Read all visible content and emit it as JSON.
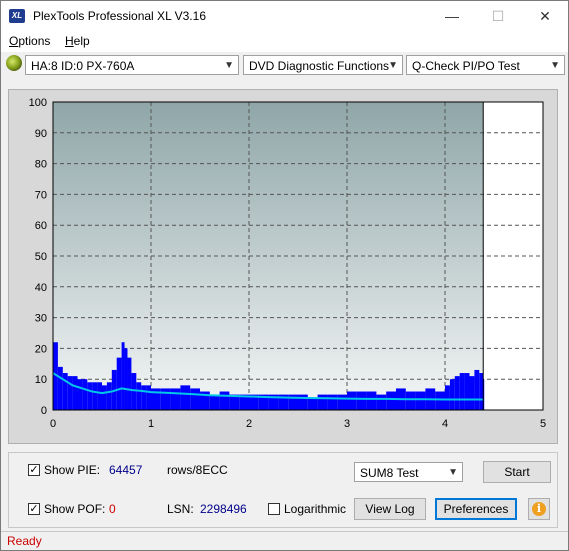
{
  "window": {
    "title": "PlexTools Professional XL V3.16",
    "icon_text": "XL",
    "minimize": "—",
    "maximize": "☐",
    "close": "✕"
  },
  "menu": {
    "options": "ptions",
    "options_hotkey": "O",
    "help": "elp",
    "help_hotkey": "H"
  },
  "toolbar": {
    "drive": "HA:8 ID:0  PX-760A",
    "function": "DVD Diagnostic Functions",
    "test": "Q-Check PI/PO Test"
  },
  "colors": {
    "plot_top": "#8fa6a8",
    "plot_bottom": "#f4f6f6",
    "bars": "#0000ff",
    "line": "#00c8e6",
    "status_text": "#cc0000",
    "value_text": "#00008b"
  },
  "chart_data": {
    "type": "bar",
    "xlim": [
      0,
      5
    ],
    "ylim": [
      0,
      100
    ],
    "x_ticks": [
      "0",
      "1",
      "2",
      "3",
      "4",
      "5"
    ],
    "y_ticks": [
      "0",
      "10",
      "20",
      "30",
      "40",
      "50",
      "60",
      "70",
      "80",
      "90",
      "100"
    ],
    "scan_end_x": 4.39,
    "grid": true,
    "series": [
      {
        "kind": "bars",
        "points": [
          [
            0.0,
            22
          ],
          [
            0.05,
            14
          ],
          [
            0.1,
            12
          ],
          [
            0.15,
            11
          ],
          [
            0.2,
            11
          ],
          [
            0.25,
            10
          ],
          [
            0.3,
            10
          ],
          [
            0.35,
            9
          ],
          [
            0.4,
            9
          ],
          [
            0.45,
            9
          ],
          [
            0.5,
            8
          ],
          [
            0.55,
            9
          ],
          [
            0.6,
            13
          ],
          [
            0.65,
            17
          ],
          [
            0.7,
            22
          ],
          [
            0.73,
            20
          ],
          [
            0.76,
            17
          ],
          [
            0.8,
            12
          ],
          [
            0.85,
            9
          ],
          [
            0.9,
            8
          ],
          [
            0.95,
            8
          ],
          [
            1.0,
            7
          ],
          [
            1.1,
            7
          ],
          [
            1.2,
            7
          ],
          [
            1.3,
            8
          ],
          [
            1.4,
            7
          ],
          [
            1.5,
            6
          ],
          [
            1.6,
            5
          ],
          [
            1.7,
            6
          ],
          [
            1.8,
            5
          ],
          [
            1.9,
            5
          ],
          [
            2.0,
            5
          ],
          [
            2.1,
            5
          ],
          [
            2.2,
            5
          ],
          [
            2.3,
            5
          ],
          [
            2.4,
            5
          ],
          [
            2.5,
            5
          ],
          [
            2.6,
            4
          ],
          [
            2.7,
            5
          ],
          [
            2.8,
            5
          ],
          [
            2.9,
            5
          ],
          [
            3.0,
            6
          ],
          [
            3.1,
            6
          ],
          [
            3.2,
            6
          ],
          [
            3.3,
            5
          ],
          [
            3.4,
            6
          ],
          [
            3.5,
            7
          ],
          [
            3.6,
            6
          ],
          [
            3.7,
            6
          ],
          [
            3.8,
            7
          ],
          [
            3.9,
            6
          ],
          [
            4.0,
            8
          ],
          [
            4.05,
            10
          ],
          [
            4.1,
            11
          ],
          [
            4.15,
            12
          ],
          [
            4.2,
            12
          ],
          [
            4.25,
            11
          ],
          [
            4.3,
            13
          ],
          [
            4.35,
            12
          ],
          [
            4.39,
            10
          ]
        ]
      },
      {
        "kind": "line",
        "points": [
          [
            0.0,
            12
          ],
          [
            0.1,
            10
          ],
          [
            0.2,
            8
          ],
          [
            0.3,
            7
          ],
          [
            0.4,
            6
          ],
          [
            0.5,
            5.5
          ],
          [
            0.6,
            6
          ],
          [
            0.7,
            7
          ],
          [
            0.8,
            6.5
          ],
          [
            0.9,
            6.2
          ],
          [
            1.0,
            5.8
          ],
          [
            1.2,
            5.5
          ],
          [
            1.4,
            5.2
          ],
          [
            1.6,
            4.8
          ],
          [
            1.8,
            4.6
          ],
          [
            2.0,
            4.4
          ],
          [
            2.2,
            4.2
          ],
          [
            2.4,
            4.0
          ],
          [
            2.6,
            3.9
          ],
          [
            2.8,
            3.8
          ],
          [
            3.0,
            3.7
          ],
          [
            3.2,
            3.6
          ],
          [
            3.4,
            3.6
          ],
          [
            3.6,
            3.5
          ],
          [
            3.8,
            3.5
          ],
          [
            4.0,
            3.4
          ],
          [
            4.2,
            3.4
          ],
          [
            4.39,
            3.4
          ]
        ]
      }
    ]
  },
  "bottom_panel": {
    "show_pie_label": "Show PIE:",
    "show_pie_checked": "✓",
    "pie_value": "64457",
    "pie_unit": "rows/8ECC",
    "show_pof_label": "Show POF:",
    "show_pof_checked": "✓",
    "pof_value": "0",
    "lsn_label": "LSN:",
    "lsn_value": "2298496",
    "logarithmic_label": "Logarithmic",
    "test_select": "SUM8 Test",
    "start_button": "Start",
    "view_log_button": "View Log",
    "preferences_button": "Preferences",
    "info_icon": "i"
  },
  "status": {
    "text": "Ready"
  }
}
